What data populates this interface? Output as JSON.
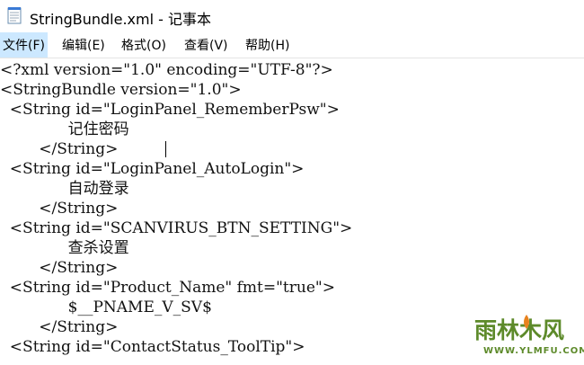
{
  "window": {
    "title": "StringBundle.xml - 记事本"
  },
  "menu": {
    "file": "文件(F)",
    "edit": "编辑(E)",
    "format": "格式(O)",
    "view": "查看(V)",
    "help": "帮助(H)"
  },
  "editor": {
    "lines": [
      "<?xml version=\"1.0\" encoding=\"UTF-8\"?>",
      "<StringBundle version=\"1.0\">",
      "  <String id=\"LoginPanel_RememberPsw\">",
      "              记住密码",
      "        </String>",
      "  <String id=\"LoginPanel_AutoLogin\">",
      "              自动登录",
      "        </String>",
      "  <String id=\"SCANVIRUS_BTN_SETTING\">",
      "              查杀设置",
      "        </String>",
      "  <String id=\"Product_Name\" fmt=\"true\">",
      "              $__PNAME_V_SV$",
      "        </String>",
      "  <String id=\"ContactStatus_ToolTip\">"
    ]
  },
  "watermark": {
    "logo_text": "雨林木风",
    "url": "WWW.YLMFU.COM"
  },
  "colors": {
    "menu_highlight": "#cce8ff",
    "watermark_green": "#5d8a2a",
    "watermark_orange": "#e8821e"
  }
}
